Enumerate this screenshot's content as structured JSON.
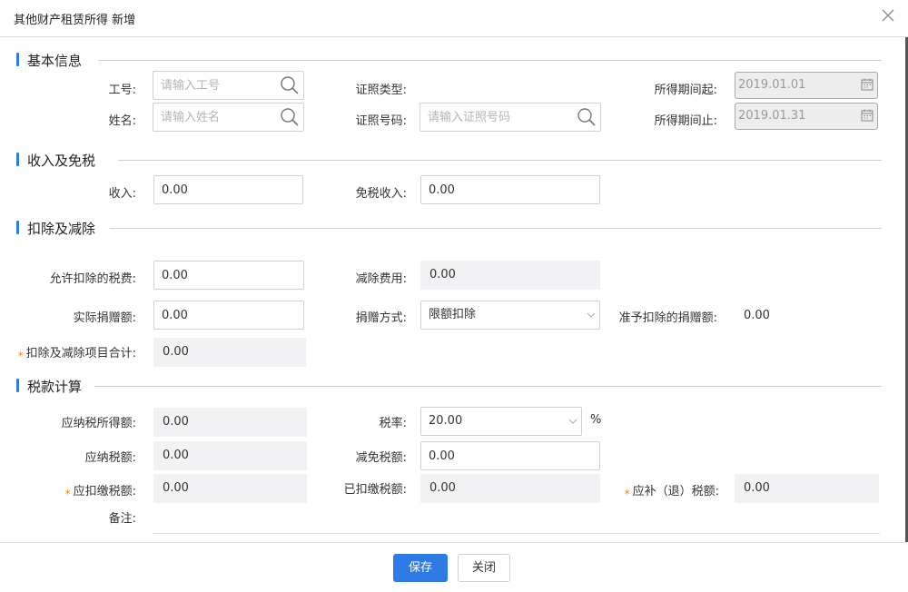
{
  "dialog": {
    "title": "其他财产租赁所得 新增"
  },
  "sections": {
    "basic": "基本信息",
    "income": "收入及免税",
    "deduction": "扣除及减除",
    "tax": "税款计算"
  },
  "basic": {
    "employee_no_label": "工号:",
    "employee_no_placeholder": "请输入工号",
    "name_label": "姓名:",
    "name_placeholder": "请输入姓名",
    "id_type_label": "证照类型:",
    "id_no_label": "证照号码:",
    "id_no_placeholder": "请输入证照号码",
    "period_start_label": "所得期间起:",
    "period_start_value": "2019.01.01",
    "period_end_label": "所得期间止:",
    "period_end_value": "2019.01.31"
  },
  "income": {
    "income_label": "收入:",
    "income_value": "0.00",
    "exempt_label": "免税收入:",
    "exempt_value": "0.00"
  },
  "deduction": {
    "allowed_tax_label": "允许扣除的税费:",
    "allowed_tax_value": "0.00",
    "reduction_label": "减除费用:",
    "reduction_value": "0.00",
    "donation_label": "实际捐赠额:",
    "donation_value": "0.00",
    "donation_method_label": "捐赠方式:",
    "donation_method_value": "限额扣除",
    "allowed_donation_label": "准予扣除的捐赠额:",
    "allowed_donation_value": "0.00",
    "total_label": "扣除及减除项目合计:",
    "total_value": "0.00",
    "required_mark": "*"
  },
  "tax": {
    "taxable_income_label": "应纳税所得额:",
    "taxable_income_value": "0.00",
    "rate_label": "税率:",
    "rate_value": "20.00",
    "rate_unit": "%",
    "tax_payable_label": "应纳税额:",
    "tax_payable_value": "0.00",
    "tax_relief_label": "减免税额:",
    "tax_relief_value": "0.00",
    "withholding_label": "应扣缴税额:",
    "withholding_value": "0.00",
    "withheld_label": "已扣缴税额:",
    "withheld_value": "0.00",
    "refund_label": "应补（退）税额:",
    "refund_value": "0.00",
    "remarks_label": "备注:",
    "required_mark": "*"
  },
  "footer": {
    "save_label": "保存",
    "close_label": "关闭"
  },
  "colors": {
    "accent": "#2f7be6",
    "required": "#f08a24",
    "readonly_bg": "#f2f2f4"
  }
}
